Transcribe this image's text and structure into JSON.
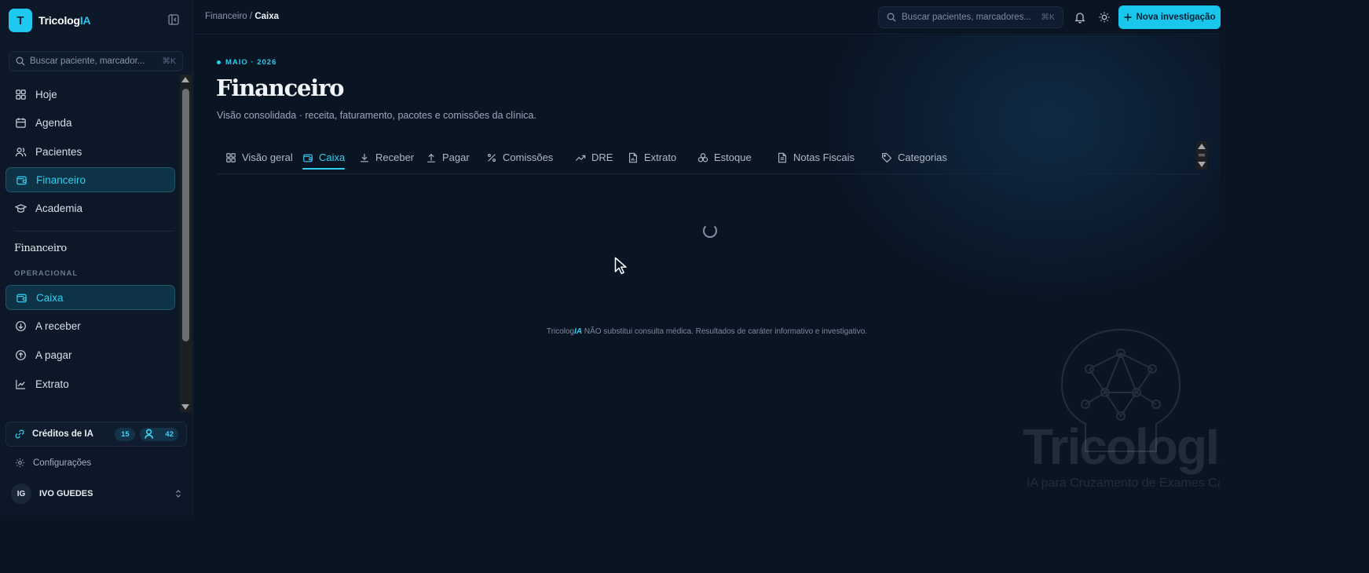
{
  "brand": {
    "logo_letter": "T",
    "name_prefix": "Tricolog",
    "name_accent": "IA"
  },
  "sidebar": {
    "search_placeholder": "Buscar paciente, marcador...",
    "search_shortcut": "⌘K",
    "nav": [
      {
        "label": "Hoje",
        "icon": "grid-icon"
      },
      {
        "label": "Agenda",
        "icon": "calendar-icon"
      },
      {
        "label": "Pacientes",
        "icon": "users-icon"
      },
      {
        "label": "Financeiro",
        "icon": "wallet-icon",
        "active": true
      },
      {
        "label": "Academia",
        "icon": "graduation-cap-icon"
      }
    ],
    "section_title": "Financeiro",
    "group_label": "OPERACIONAL",
    "sub_nav": [
      {
        "label": "Caixa",
        "icon": "wallet-icon",
        "active": true
      },
      {
        "label": "A receber",
        "icon": "arrow-down-circle-icon"
      },
      {
        "label": "A pagar",
        "icon": "arrow-up-circle-icon"
      },
      {
        "label": "Extrato",
        "icon": "chart-line-icon"
      }
    ],
    "credits": {
      "label": "Créditos de IA",
      "badge1": "15",
      "badge2": "42"
    },
    "settings_label": "Configurações",
    "user": {
      "initials": "IG",
      "name": "IVO GUEDES"
    }
  },
  "topbar": {
    "breadcrumb_parent": "Financeiro",
    "breadcrumb_sep": "/",
    "breadcrumb_current": "Caixa",
    "search_placeholder": "Buscar pacientes, marcadores...",
    "search_shortcut": "⌘K",
    "cta_label": "Nova investigação"
  },
  "main": {
    "eyebrow": "MAIO · 2026",
    "title": "Financeiro",
    "subtitle": "Visão consolidada · receita, faturamento, pacotes e comissões da clínica.",
    "tabs": [
      {
        "label": "Visão geral",
        "icon": "grid-icon"
      },
      {
        "label": "Caixa",
        "icon": "wallet-icon",
        "active": true
      },
      {
        "label": "Receber",
        "icon": "download-icon"
      },
      {
        "label": "Pagar",
        "icon": "upload-icon"
      },
      {
        "label": "Comissões",
        "icon": "percent-icon"
      },
      {
        "label": "DRE",
        "icon": "trending-up-icon"
      },
      {
        "label": "Extrato",
        "icon": "file-chart-icon"
      },
      {
        "label": "Estoque",
        "icon": "boxes-icon"
      },
      {
        "label": "Notas Fiscais",
        "icon": "file-text-icon"
      },
      {
        "label": "Categorias",
        "icon": "tag-icon"
      }
    ],
    "disclaimer_prefix": "Tricolog",
    "disclaimer_accent": "IA",
    "disclaimer_text": " NÃO substitui consulta médica. Resultados de caráter informativo e investigativo.",
    "watermark_title": "TricologIA",
    "watermark_sub": "IA para Cruzamento de Exames Capilares"
  },
  "colors": {
    "accent": "#1fc8ef",
    "background": "#0a1524",
    "sidebar": "#0c1828"
  }
}
